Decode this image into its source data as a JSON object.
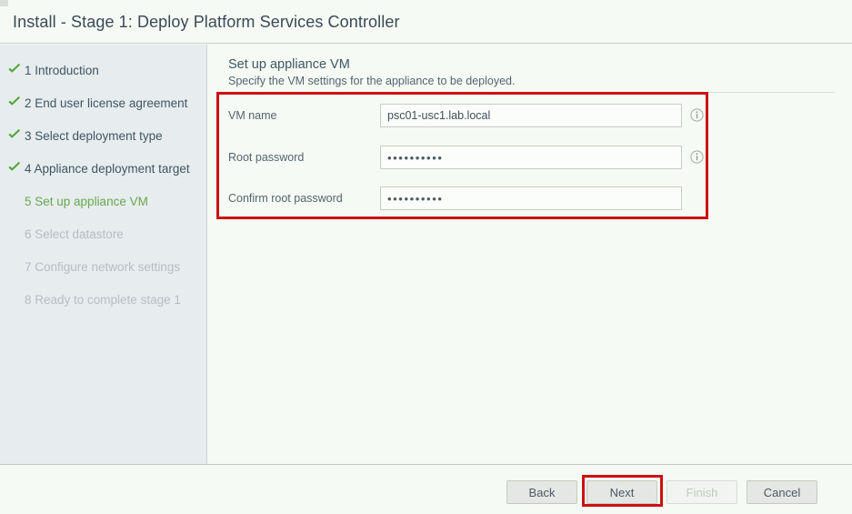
{
  "window": {
    "title": "Install - Stage 1: Deploy Platform Services Controller"
  },
  "sidebar": {
    "steps": [
      {
        "label": "1 Introduction",
        "state": "done"
      },
      {
        "label": "2 End user license agreement",
        "state": "done"
      },
      {
        "label": "3 Select deployment type",
        "state": "done"
      },
      {
        "label": "4 Appliance deployment target",
        "state": "done"
      },
      {
        "label": "5 Set up appliance VM",
        "state": "active"
      },
      {
        "label": "6 Select datastore",
        "state": "todo"
      },
      {
        "label": "7 Configure network settings",
        "state": "todo"
      },
      {
        "label": "8 Ready to complete stage 1",
        "state": "todo"
      }
    ]
  },
  "content": {
    "title": "Set up appliance VM",
    "subtitle": "Specify the VM settings for the appliance to be deployed.",
    "fields": [
      {
        "label": "VM name",
        "value": "psc01-usc1.lab.local",
        "placeholder": "",
        "type": "text",
        "has_info_icon": true,
        "icon": "info-icon"
      },
      {
        "label": "Root password",
        "value": "••••••••••",
        "placeholder": "",
        "type": "password",
        "has_info_icon": true,
        "icon": "info-icon"
      },
      {
        "label": "Confirm root password",
        "value": "••••••••••",
        "placeholder": "",
        "type": "password",
        "has_info_icon": false,
        "icon": ""
      }
    ]
  },
  "footer": {
    "back_label": "Back",
    "next_label": "Next",
    "finish_label": "Finish",
    "cancel_label": "Cancel"
  },
  "colors": {
    "highlight_red": "#cc1111",
    "step_done": "#3f5664",
    "step_active": "#6aa84f",
    "step_todo": "#b6bdc2",
    "checkmark_green": "#4ca632",
    "sidebar_bg": "#e7ecee",
    "content_bg": "#f6faf4"
  },
  "annotations": {
    "form_highlight": "red-rectangle-around-vm-settings-form",
    "next_highlight": "red-rectangle-around-next-button"
  }
}
